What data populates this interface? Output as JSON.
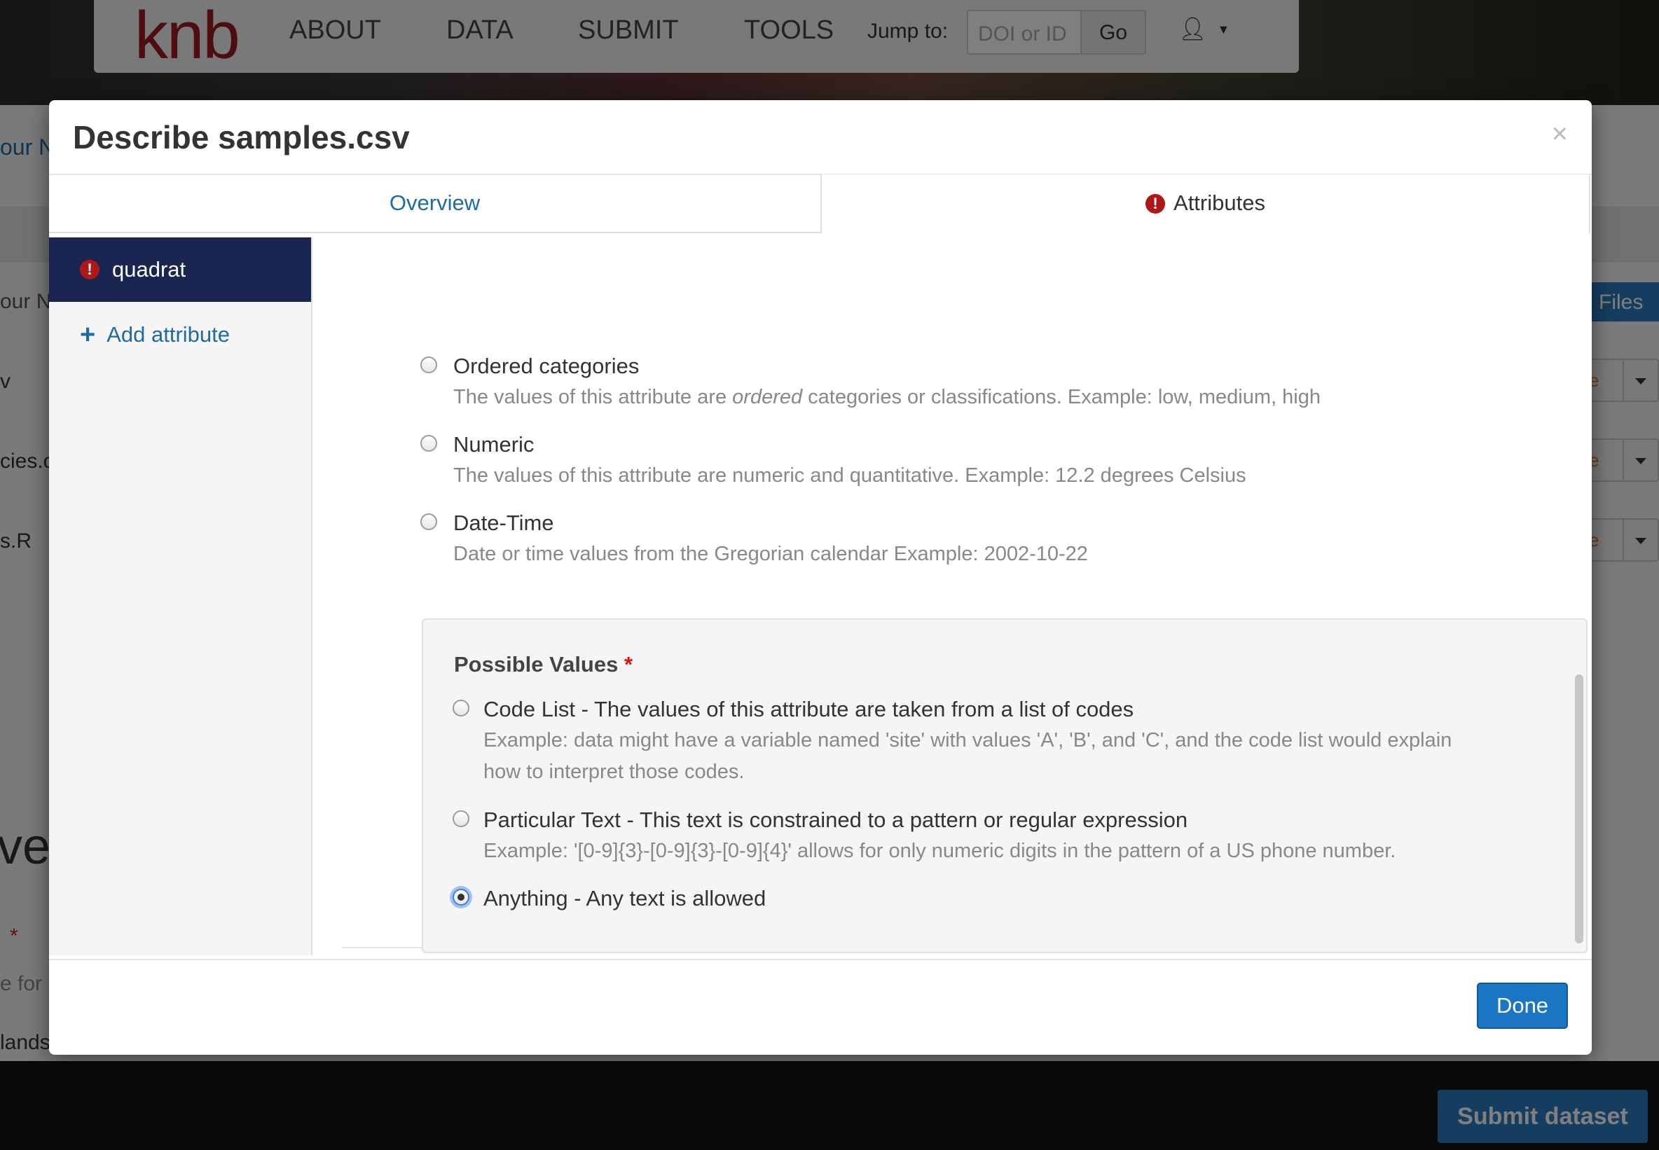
{
  "background": {
    "logo": "knb",
    "nav": [
      "ABOUT",
      "DATA",
      "SUBMIT",
      "TOOLS"
    ],
    "jump_label": "Jump to:",
    "doi_placeholder": "DOI or ID",
    "go_label": "Go",
    "files_button": "Files",
    "side_text_1": "our N",
    "side_text_2": "our N",
    "row_1": "v",
    "row_2": "cies.c",
    "row_3": "s.R",
    "big_text": "ve",
    "req_text": "*",
    "hint_text": "e for",
    "lands_text": "lands",
    "submit_button": "Submit dataset"
  },
  "modal": {
    "title": "Describe samples.csv",
    "close_label": "×",
    "tabs": {
      "overview": "Overview",
      "attributes": "Attributes",
      "attributes_error_icon": "!"
    },
    "sidebar": {
      "active_item": "quadrat",
      "active_error_icon": "!",
      "add_plus": "+",
      "add_label": "Add attribute"
    },
    "measurement_options": [
      {
        "label": "Ordered categories",
        "desc_prefix": "The values of this attribute are ",
        "desc_em": "ordered",
        "desc_suffix": " categories or classifications. Example: low, medium, high"
      },
      {
        "label": "Numeric",
        "desc": "The values of this attribute are numeric and quantitative. Example: 12.2 degrees Celsius"
      },
      {
        "label": "Date-Time",
        "desc": "Date or time values from the Gregorian calendar Example: 2002-10-22"
      }
    ],
    "possible_values": {
      "title": "Possible Values",
      "required_mark": "*",
      "options": [
        {
          "label": "Code List - The values of this attribute are taken from a list of codes",
          "desc_line1": "Example: data might have a variable named 'site' with values 'A', 'B', and 'C', and the code list would explain",
          "desc_line2": "how to interpret those codes.",
          "checked": false
        },
        {
          "label": "Particular Text - This text is constrained to a pattern or regular expression",
          "desc": "Example: '[0-9]{3}-[0-9]{3}-[0-9]{4}' allows for only numeric digits in the pattern of a US phone number.",
          "checked": false
        },
        {
          "label": "Anything - Any text is allowed",
          "checked": true
        }
      ]
    },
    "done_label": "Done"
  },
  "colors": {
    "accent": "#1a76c2",
    "link": "#1f6aa0",
    "sidebar_active": "#1b2551",
    "error": "#b01818"
  },
  "icons": {
    "attributes_tab": "exclamation-circle-icon",
    "sidebar_item": "exclamation-circle-icon",
    "add": "plus-icon",
    "close": "close-icon",
    "user": "user-icon"
  }
}
